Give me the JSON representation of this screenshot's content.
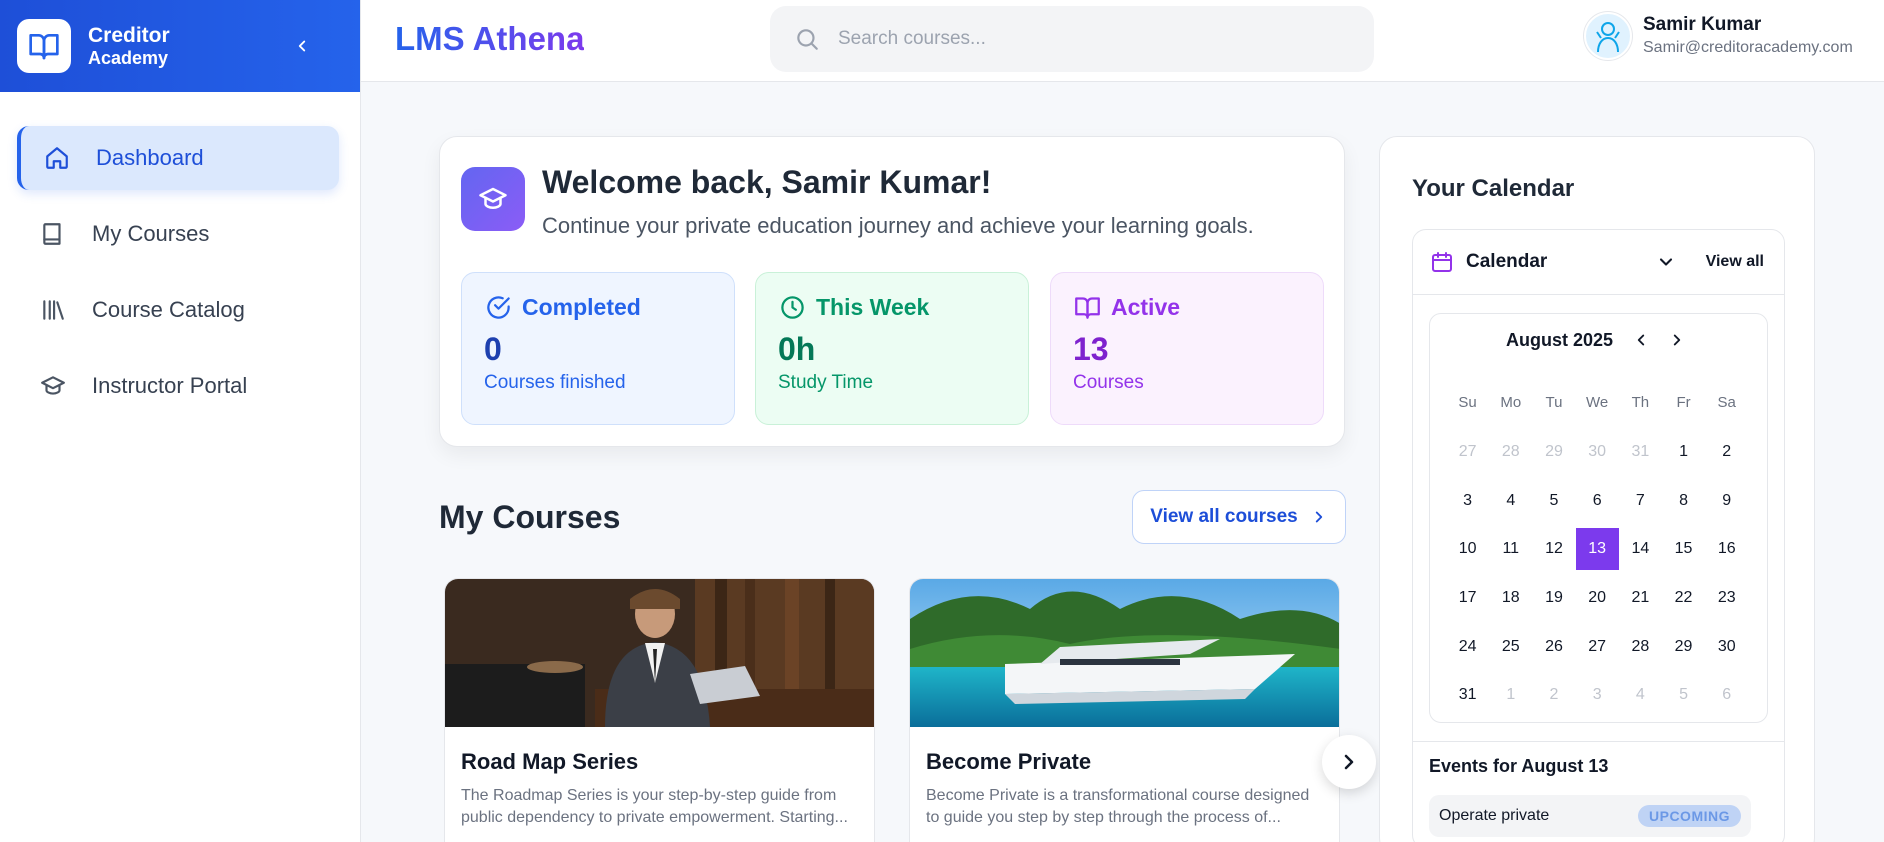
{
  "brand": {
    "name": "Creditor",
    "sub": "Academy"
  },
  "sidebar": {
    "items": [
      {
        "label": "Dashboard",
        "icon": "home-icon",
        "active": true
      },
      {
        "label": "My Courses",
        "icon": "book-icon",
        "active": false
      },
      {
        "label": "Course Catalog",
        "icon": "library-icon",
        "active": false
      },
      {
        "label": "Instructor Portal",
        "icon": "graduation-cap-icon",
        "active": false
      }
    ]
  },
  "header": {
    "title": "LMS Athena",
    "search_placeholder": "Search courses...",
    "user_name": "Samir Kumar",
    "user_email": "Samir@creditoracademy.com"
  },
  "welcome": {
    "title": "Welcome back, Samir Kumar!",
    "subtitle": "Continue your private education journey and achieve your learning goals.",
    "stats": [
      {
        "label": "Completed",
        "value": "0",
        "caption": "Courses finished",
        "color": "#2563eb"
      },
      {
        "label": "This Week",
        "value": "0h",
        "caption": "Study Time",
        "color": "#059669"
      },
      {
        "label": "Active",
        "value": "13",
        "caption": "Courses",
        "color": "#9333ea"
      }
    ]
  },
  "courses": {
    "title": "My Courses",
    "view_all": "View all courses",
    "items": [
      {
        "title": "Road Map Series",
        "description": "The Roadmap Series is your step-by-step guide from public dependency to private empowerment. Starting..."
      },
      {
        "title": "Become Private",
        "description": "Become Private is a transformational course designed to guide you step by step through the process of..."
      }
    ]
  },
  "calendar": {
    "panel_title": "Your Calendar",
    "label": "Calendar",
    "view_all": "View all",
    "month": "August 2025",
    "weekdays": [
      "Su",
      "Mo",
      "Tu",
      "We",
      "Th",
      "Fr",
      "Sa"
    ],
    "days": [
      {
        "d": "27",
        "m": true
      },
      {
        "d": "28",
        "m": true
      },
      {
        "d": "29",
        "m": true
      },
      {
        "d": "30",
        "m": true
      },
      {
        "d": "31",
        "m": true
      },
      {
        "d": "1"
      },
      {
        "d": "2"
      },
      {
        "d": "3"
      },
      {
        "d": "4"
      },
      {
        "d": "5"
      },
      {
        "d": "6"
      },
      {
        "d": "7"
      },
      {
        "d": "8"
      },
      {
        "d": "9"
      },
      {
        "d": "10"
      },
      {
        "d": "11"
      },
      {
        "d": "12"
      },
      {
        "d": "13",
        "s": true
      },
      {
        "d": "14"
      },
      {
        "d": "15"
      },
      {
        "d": "16"
      },
      {
        "d": "17"
      },
      {
        "d": "18"
      },
      {
        "d": "19"
      },
      {
        "d": "20"
      },
      {
        "d": "21"
      },
      {
        "d": "22"
      },
      {
        "d": "23"
      },
      {
        "d": "24"
      },
      {
        "d": "25"
      },
      {
        "d": "26"
      },
      {
        "d": "27"
      },
      {
        "d": "28"
      },
      {
        "d": "29"
      },
      {
        "d": "30"
      },
      {
        "d": "31"
      },
      {
        "d": "1",
        "m": true
      },
      {
        "d": "2",
        "m": true
      },
      {
        "d": "3",
        "m": true
      },
      {
        "d": "4",
        "m": true
      },
      {
        "d": "5",
        "m": true
      },
      {
        "d": "6",
        "m": true
      }
    ],
    "selected_color": "#7c3aed",
    "events_title": "Events for August 13",
    "events": [
      {
        "name": "Operate private",
        "status": "UPCOMING"
      }
    ]
  }
}
